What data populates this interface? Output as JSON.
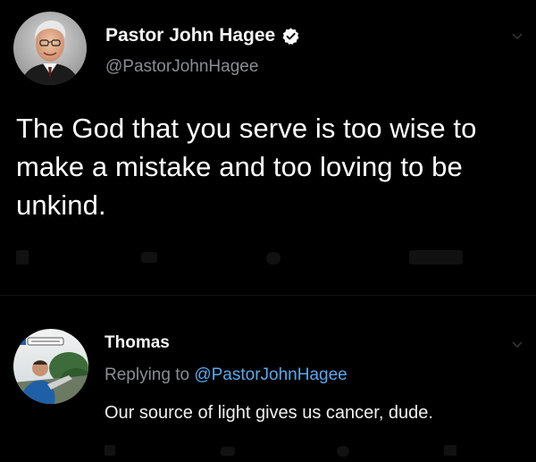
{
  "tweet": {
    "author_name": "Pastor John Hagee",
    "author_handle": "@PastorJohnHagee",
    "verified": true,
    "text": "The God that you serve is too wise to make a mistake and too loving to be unkind."
  },
  "reply": {
    "author_name": "Thomas",
    "replying_label": "Replying to",
    "replying_handle": "@PastorJohnHagee",
    "text": "Our source of light gives us cancer, dude."
  },
  "colors": {
    "background": "#000000",
    "text": "#ffffff",
    "secondary_text": "#8a8d91",
    "mention": "#5aa8ee",
    "verified_badge": "#ffffff"
  }
}
